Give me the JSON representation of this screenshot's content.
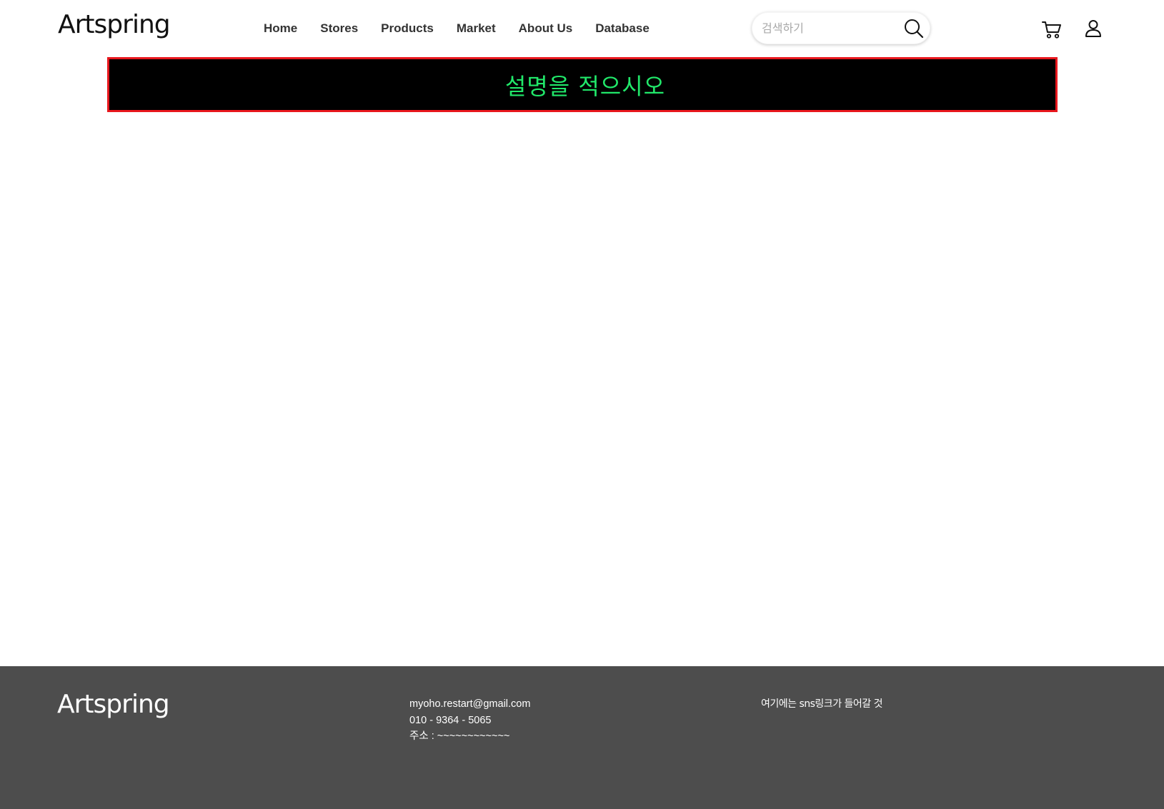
{
  "header": {
    "logo": "Artspring",
    "nav": [
      {
        "label": "Home"
      },
      {
        "label": "Stores"
      },
      {
        "label": "Products"
      },
      {
        "label": "Market"
      },
      {
        "label": "About Us"
      },
      {
        "label": "Database"
      }
    ],
    "search": {
      "placeholder": "검색하기",
      "value": "",
      "icon": "search-icon"
    },
    "icons": {
      "cart": "cart-icon",
      "user": "user-icon"
    }
  },
  "banner": {
    "text": "설명을 적으시오",
    "text_color": "#21e86a",
    "background_color": "#000000",
    "border_color": "#e8171d"
  },
  "footer": {
    "logo": "Artspring",
    "email": "myoho.restart@gmail.com",
    "phone": "010 - 9364 - 5065",
    "address": "주소 : ~~~~~~~~~~~~",
    "sns_note": "여기에는 sns링크가 들어갈 것",
    "background_color": "#4d4d4d"
  }
}
